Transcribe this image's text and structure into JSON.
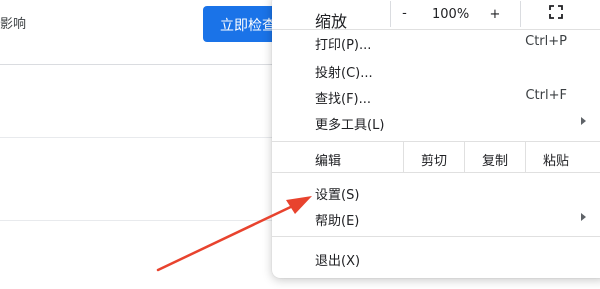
{
  "background": {
    "text_fragment": "影响",
    "button_label": "立即检查"
  },
  "menu": {
    "zoom": {
      "label": "缩放",
      "minus": "-",
      "value": "100%",
      "plus": "+"
    },
    "items_group1": [
      {
        "label": "打印(P)...",
        "shortcut": "Ctrl+P"
      },
      {
        "label": "投射(C)...",
        "shortcut": ""
      },
      {
        "label": "查找(F)...",
        "shortcut": "Ctrl+F"
      },
      {
        "label": "更多工具(L)",
        "shortcut": ""
      }
    ],
    "edit": {
      "label": "编辑",
      "cut": "剪切",
      "copy": "复制",
      "paste": "粘贴"
    },
    "items_group2": [
      {
        "label": "设置(S)"
      },
      {
        "label": "帮助(E)"
      }
    ],
    "exit": {
      "label": "退出(X)"
    }
  },
  "colors": {
    "accent_button": "#1a73e8",
    "annotation_arrow": "#e8432e"
  },
  "icons": [
    "fullscreen-icon",
    "submenu-arrow-icon"
  ]
}
